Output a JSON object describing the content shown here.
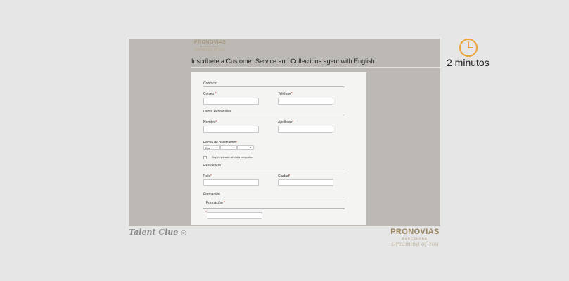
{
  "header": {
    "brand_small": "PRONOVIAS",
    "brand_small_sub": "BARCELONA",
    "brand_small_script": "Dreaming of You",
    "title": "Inscríbete a Customer Service and Collections agent with English"
  },
  "form": {
    "sections": {
      "contacto": "Contacto",
      "datos": "Datos Personales",
      "residencia": "Residencia",
      "formacion": "Formación"
    },
    "labels": {
      "correo": "Correo",
      "telefono": "Teléfono",
      "nombre": "Nombre",
      "apellidos": "Apellidos",
      "fecha": "Fecha de nacimiento",
      "pais": "País",
      "ciudad": "Ciudad",
      "formacion": "Formación"
    },
    "required_mark": "*",
    "dob": {
      "day_value": "Día",
      "month_value": "",
      "year_value": ""
    },
    "employee_checkbox_label": "Soy empleado de esta compañía"
  },
  "side": {
    "duration": "2 minutos"
  },
  "footer": {
    "talentclue": "Talent Clue",
    "pronovias": "PRONOVIAS",
    "pronovias_sub": "BARCELONA",
    "pronovias_script": "Dreaming of You"
  }
}
